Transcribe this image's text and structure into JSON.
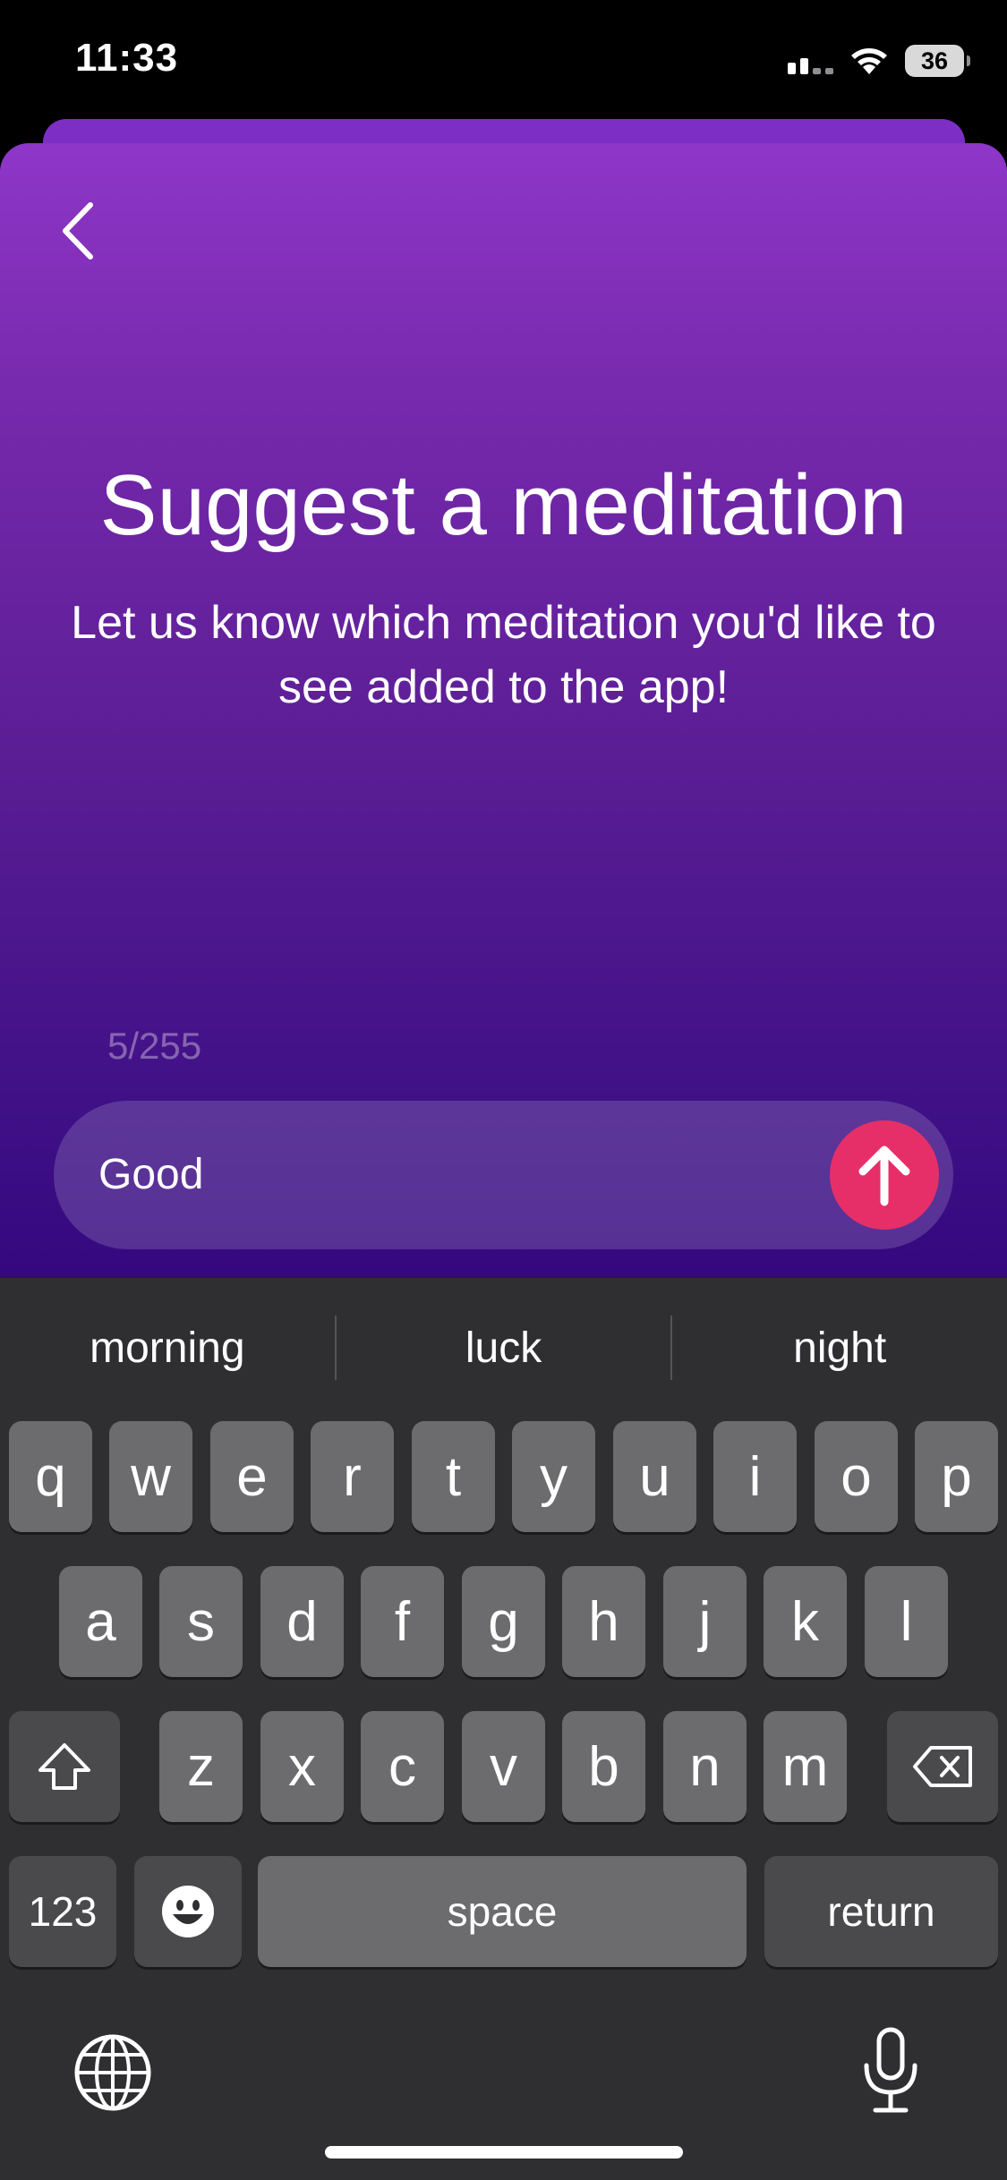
{
  "status_bar": {
    "time": "11:33",
    "battery": "36"
  },
  "header": {
    "back_label": ""
  },
  "main": {
    "title": "Suggest a meditation",
    "subtitle": "Let us know which meditation you'd like to see added to the app!",
    "counter": "5/255",
    "input_value": "Good"
  },
  "keyboard": {
    "suggestions": [
      "morning",
      "luck",
      "night"
    ],
    "row1": [
      "q",
      "w",
      "e",
      "r",
      "t",
      "y",
      "u",
      "i",
      "o",
      "p"
    ],
    "row2": [
      "a",
      "s",
      "d",
      "f",
      "g",
      "h",
      "j",
      "k",
      "l"
    ],
    "row3": [
      "z",
      "x",
      "c",
      "v",
      "b",
      "n",
      "m"
    ],
    "numbers_label": "123",
    "space_label": "space",
    "return_label": "return"
  },
  "colors": {
    "accent": "#e62f69",
    "sheet_top": "#8e36c8",
    "sheet_bottom": "#35087f",
    "keyboard_bg": "#2f2f31"
  },
  "icons": [
    "chevron-left-icon",
    "arrow-up-icon",
    "shift-icon",
    "backspace-icon",
    "emoji-icon",
    "globe-icon",
    "microphone-icon",
    "wifi-icon",
    "cellular-signal-icon",
    "battery-icon"
  ]
}
